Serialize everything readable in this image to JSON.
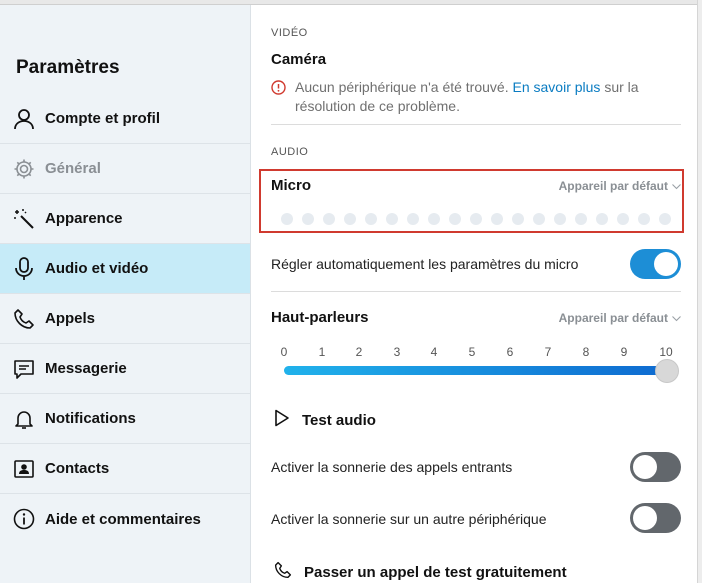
{
  "sidebar": {
    "title": "Paramètres",
    "items": [
      {
        "label": "Compte et profil",
        "icon": "person-icon"
      },
      {
        "label": "Général",
        "icon": "gear-icon"
      },
      {
        "label": "Apparence",
        "icon": "magic-wand-icon"
      },
      {
        "label": "Audio et vidéo",
        "icon": "microphone-icon"
      },
      {
        "label": "Appels",
        "icon": "phone-icon"
      },
      {
        "label": "Messagerie",
        "icon": "chat-icon"
      },
      {
        "label": "Notifications",
        "icon": "bell-icon"
      },
      {
        "label": "Contacts",
        "icon": "contact-card-icon"
      },
      {
        "label": "Aide et commentaires",
        "icon": "info-icon"
      }
    ],
    "active_index": 3
  },
  "video": {
    "section_label": "VIDÉO",
    "camera_title": "Caméra",
    "warning_before": "Aucun périphérique n'a été trouvé.",
    "warning_link": "En savoir plus",
    "warning_after": "sur la résolution de ce problème."
  },
  "audio": {
    "section_label": "AUDIO",
    "micro_title": "Micro",
    "micro_device": "Appareil par défaut",
    "auto_adjust_label": "Régler automatiquement les paramètres du micro",
    "auto_adjust_on": true,
    "speakers_title": "Haut-parleurs",
    "speakers_device": "Appareil par défaut",
    "volume_ticks": [
      "0",
      "1",
      "2",
      "3",
      "4",
      "5",
      "6",
      "7",
      "8",
      "9",
      "10"
    ],
    "volume_value": 10,
    "test_audio_label": "Test audio",
    "ring_incoming_label": "Activer la sonnerie des appels entrants",
    "ring_incoming_on": false,
    "ring_other_label": "Activer la sonnerie sur un autre périphérique",
    "ring_other_on": false,
    "free_test_call_label": "Passer un appel de test gratuitement"
  },
  "colors": {
    "accent": "#1d8ed6",
    "link": "#0a7cc2",
    "highlight_box": "#d03a2f",
    "active_sidebar": "#c6ebf8"
  }
}
